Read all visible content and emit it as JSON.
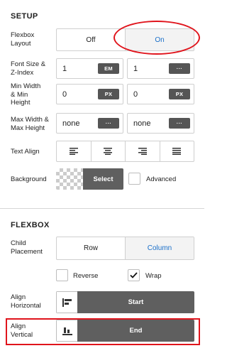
{
  "setup": {
    "title": "SETUP",
    "flexbox_layout": {
      "label": "Flexbox\nLayout",
      "options": [
        "Off",
        "On"
      ],
      "selected": "On"
    },
    "font_size": {
      "label": "Font Size &\nZ-Index",
      "font_value": "1",
      "font_unit": "EM",
      "z_value": "1",
      "z_unit": "···"
    },
    "min_size": {
      "label": "Min Width\n& Min\nHeight",
      "width_value": "0",
      "width_unit": "PX",
      "height_value": "0",
      "height_unit": "PX"
    },
    "max_size": {
      "label": "Max Width &\nMax Height",
      "width_value": "none",
      "width_unit": "···",
      "height_value": "none",
      "height_unit": "···"
    },
    "text_align": {
      "label": "Text Align",
      "options": [
        "align-left-icon",
        "align-center-icon",
        "align-right-icon",
        "align-justify-icon"
      ]
    },
    "background": {
      "label": "Background",
      "select_label": "Select",
      "advanced_label": "Advanced",
      "advanced_checked": false
    }
  },
  "flexbox": {
    "title": "FLEXBOX",
    "child_placement": {
      "label": "Child\nPlacement",
      "options": [
        "Row",
        "Column"
      ],
      "selected": "Column"
    },
    "reverse": {
      "label": "Reverse",
      "checked": false
    },
    "wrap": {
      "label": "Wrap",
      "checked": true
    },
    "align_horizontal": {
      "label": "Align\nHorizontal",
      "value": "Start",
      "icon": "align-start-icon"
    },
    "align_vertical": {
      "label": "Align\nVertical",
      "value": "End",
      "icon": "align-end-icon"
    }
  },
  "colors": {
    "accent": "#1a6fc9",
    "highlight": "#e0141c",
    "dark_button": "#5f5f5f"
  }
}
